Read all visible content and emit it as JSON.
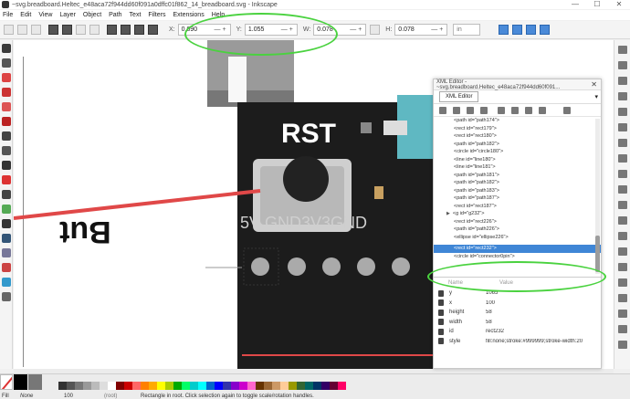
{
  "window": {
    "title": "~svg.breadboard.Heltec_e48aca72f944dd60f091a0dffc01f862_14_breadboard.svg - Inkscape",
    "controls": [
      "—",
      "☐",
      "✕"
    ]
  },
  "menu": [
    "File",
    "Edit",
    "View",
    "Layer",
    "Object",
    "Path",
    "Text",
    "Filters",
    "Extensions",
    "Help"
  ],
  "toolbar": {
    "x_label": "X:",
    "x_value": "0.090",
    "y_label": "Y:",
    "y_value": "1.055",
    "w_label": "W:",
    "w_value": "0.078",
    "h_label": "H:",
    "h_value": "0.078",
    "unit": "in"
  },
  "canvas": {
    "text_rst": "RST",
    "text_pins": "5V GND3V3GND",
    "text_but": "But",
    "colors": {
      "board": "#1c1c1c",
      "teal": "#5fb8c2",
      "red_line": "#e04848"
    }
  },
  "xml_editor": {
    "window_title": "XML Editor - ~svg.breadboard.Heltec_e48aca72f944dd60f091...",
    "tab_label": "XML Editor",
    "nodes": [
      {
        "text": "<path id=\"path174\">"
      },
      {
        "text": "<rect id=\"rect179\">"
      },
      {
        "text": "<rect id=\"rect180\">"
      },
      {
        "text": "<path id=\"path182\">"
      },
      {
        "text": "<circle id=\"circle180\">"
      },
      {
        "text": "<line id=\"line180\">"
      },
      {
        "text": "<line id=\"line181\">"
      },
      {
        "text": "<path id=\"path181\">"
      },
      {
        "text": "<path id=\"path182\">"
      },
      {
        "text": "<path id=\"path183\">"
      },
      {
        "text": "<path id=\"path187\">"
      },
      {
        "text": "<rect id=\"rect187\">"
      },
      {
        "text": "<g id=\"g232\">"
      },
      {
        "text": "<rect id=\"rect226\">"
      },
      {
        "text": "<path id=\"path226\">"
      },
      {
        "text": "<ellipse id=\"ellipse226\">"
      },
      {
        "text": "<rect id=\"rect232\">"
      },
      {
        "text": "<circle id=\"connector0pin\">"
      }
    ],
    "attr_header": {
      "name": "Name",
      "value": "Value"
    },
    "attributes": [
      {
        "name": "y",
        "value": "1065"
      },
      {
        "name": "x",
        "value": "100"
      },
      {
        "name": "height",
        "value": "58"
      },
      {
        "name": "width",
        "value": "58"
      },
      {
        "name": "id",
        "value": "rect232"
      },
      {
        "name": "style",
        "value": "fill:none;stroke:#999999;stroke-width:20"
      }
    ]
  },
  "statusbar": {
    "fill_label": "Fill",
    "stroke_label": "Stroke",
    "fill_value": "None",
    "opacity": "100",
    "layer": "(root)",
    "message": "Rectangle in root. Click selection again to toggle scale/rotation handles."
  },
  "palette": [
    "#333333",
    "#555555",
    "#777777",
    "#999999",
    "#bbbbbb",
    "#dddddd",
    "#ffffff",
    "#800000",
    "#cc0000",
    "#ff6666",
    "#ff8000",
    "#ffaa00",
    "#ffff00",
    "#aacc00",
    "#00aa00",
    "#00ff66",
    "#00cccc",
    "#00ffff",
    "#0066cc",
    "#0000ff",
    "#3333aa",
    "#8800cc",
    "#cc00cc",
    "#ff66cc",
    "#663300",
    "#996633",
    "#cc9966",
    "#ffcc99",
    "#999900",
    "#336633",
    "#006666",
    "#003366",
    "#330066",
    "#660033",
    "#ff0066"
  ]
}
